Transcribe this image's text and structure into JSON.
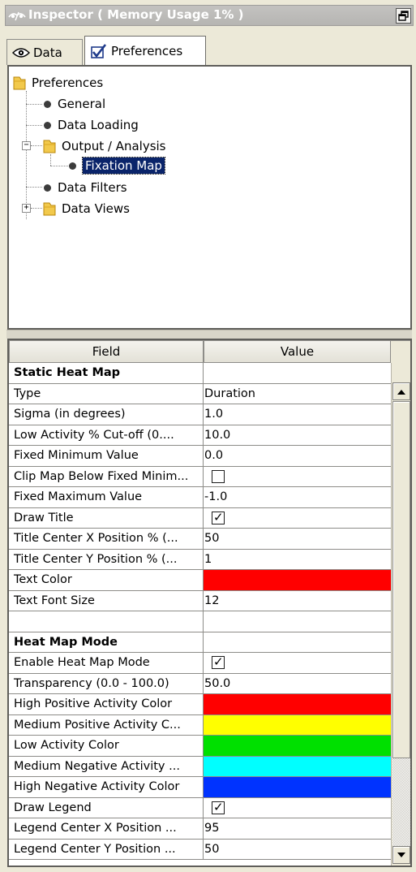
{
  "window": {
    "title": "Inspector ( Memory Usage 1% )"
  },
  "tabs": [
    {
      "label": "Data",
      "icon": "eye-icon",
      "active": false
    },
    {
      "label": "Preferences",
      "icon": "checkbox-icon",
      "active": true
    }
  ],
  "tree": {
    "root": "Preferences",
    "items": [
      {
        "label": "General"
      },
      {
        "label": "Data Loading"
      },
      {
        "label": "Output / Analysis",
        "expanded": true,
        "children": [
          {
            "label": "Fixation Map",
            "selected": true
          }
        ]
      },
      {
        "label": "Data Filters"
      },
      {
        "label": "Data Views",
        "expanded": false
      }
    ]
  },
  "table": {
    "columns": [
      "Field",
      "Value"
    ],
    "rows": [
      {
        "field": "Static Heat Map",
        "value": "",
        "kind": "section"
      },
      {
        "field": "Type",
        "value": "Duration",
        "kind": "text"
      },
      {
        "field": "Sigma (in degrees)",
        "value": "1.0",
        "kind": "text"
      },
      {
        "field": "Low Activity % Cut-off (0....",
        "value": "10.0",
        "kind": "text"
      },
      {
        "field": "Fixed Minimum Value",
        "value": "0.0",
        "kind": "text"
      },
      {
        "field": "Clip Map Below Fixed Minim...",
        "value": "",
        "kind": "checkbox",
        "checked": false
      },
      {
        "field": "Fixed Maximum Value",
        "value": "-1.0",
        "kind": "text"
      },
      {
        "field": "Draw Title",
        "value": "",
        "kind": "checkbox",
        "checked": true
      },
      {
        "field": "Title Center X Position % (...",
        "value": "50",
        "kind": "text"
      },
      {
        "field": "Title Center Y Position % (...",
        "value": "1",
        "kind": "text"
      },
      {
        "field": "Text Color",
        "value": "",
        "kind": "color",
        "color": "#ff0000"
      },
      {
        "field": "Text Font Size",
        "value": "12",
        "kind": "text"
      },
      {
        "field": "",
        "value": "",
        "kind": "blank"
      },
      {
        "field": "Heat Map Mode",
        "value": "",
        "kind": "section"
      },
      {
        "field": "Enable Heat Map Mode",
        "value": "",
        "kind": "checkbox",
        "checked": true
      },
      {
        "field": "Transparency (0.0 - 100.0)",
        "value": "50.0",
        "kind": "text"
      },
      {
        "field": "High Positive Activity Color",
        "value": "",
        "kind": "color",
        "color": "#ff0000"
      },
      {
        "field": "Medium Positive Activity C...",
        "value": "",
        "kind": "color",
        "color": "#ffff00"
      },
      {
        "field": "Low Activity Color",
        "value": "",
        "kind": "color",
        "color": "#00e000"
      },
      {
        "field": "Medium Negative Activity ...",
        "value": "",
        "kind": "color",
        "color": "#00ffff"
      },
      {
        "field": "High Negative Activity Color",
        "value": "",
        "kind": "color",
        "color": "#0033ff"
      },
      {
        "field": "Draw Legend",
        "value": "",
        "kind": "checkbox",
        "checked": true
      },
      {
        "field": "Legend Center X Position ...",
        "value": "95",
        "kind": "text"
      },
      {
        "field": "Legend Center Y Position ...",
        "value": "50",
        "kind": "text"
      }
    ]
  },
  "scrollbar": {
    "up_icon": "arrow-up-icon",
    "down_icon": "arrow-down-icon"
  }
}
